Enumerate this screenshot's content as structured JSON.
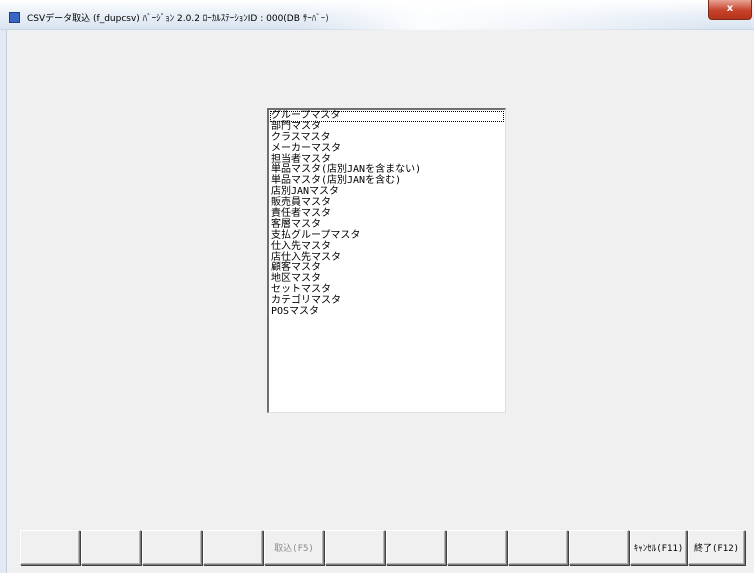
{
  "window": {
    "title": "CSVデータ取込 (f_dupcsv) ﾊﾞｰｼﾞｮﾝ 2.0.2 ﾛｰｶﾙｽﾃｰｼｮﾝID : 000(DB ｻｰﾊﾞｰ)",
    "close_label": "x",
    "icon": "app-icon"
  },
  "master_list": {
    "items": [
      "グループマスタ",
      "部門マスタ",
      "クラスマスタ",
      "メーカーマスタ",
      "担当者マスタ",
      "単品マスタ(店別JANを含まない)",
      "単品マスタ(店別JANを含む)",
      "店別JANマスタ",
      "販売員マスタ",
      "責任者マスタ",
      "客層マスタ",
      "支払グループマスタ",
      "仕入先マスタ",
      "店仕入先マスタ",
      "顧客マスタ",
      "地区マスタ",
      "セットマスタ",
      "カテゴリマスタ",
      "POSマスタ"
    ],
    "focused_index": 0
  },
  "function_keys": [
    {
      "label": ""
    },
    {
      "label": ""
    },
    {
      "label": ""
    },
    {
      "label": ""
    },
    {
      "label": "取込(F5)",
      "disabled": true
    },
    {
      "label": ""
    },
    {
      "label": ""
    },
    {
      "label": ""
    },
    {
      "label": ""
    },
    {
      "label": ""
    },
    {
      "label": "ｷｬﾝｾﾙ(F11)"
    },
    {
      "label": "終了(F12)"
    }
  ],
  "colors": {
    "window_background": "#f0f0f0",
    "titlebar": "#dbe5f1",
    "close_button": "#c7422b",
    "list_background": "#ffffff",
    "disabled_text": "#8c8c8c"
  }
}
